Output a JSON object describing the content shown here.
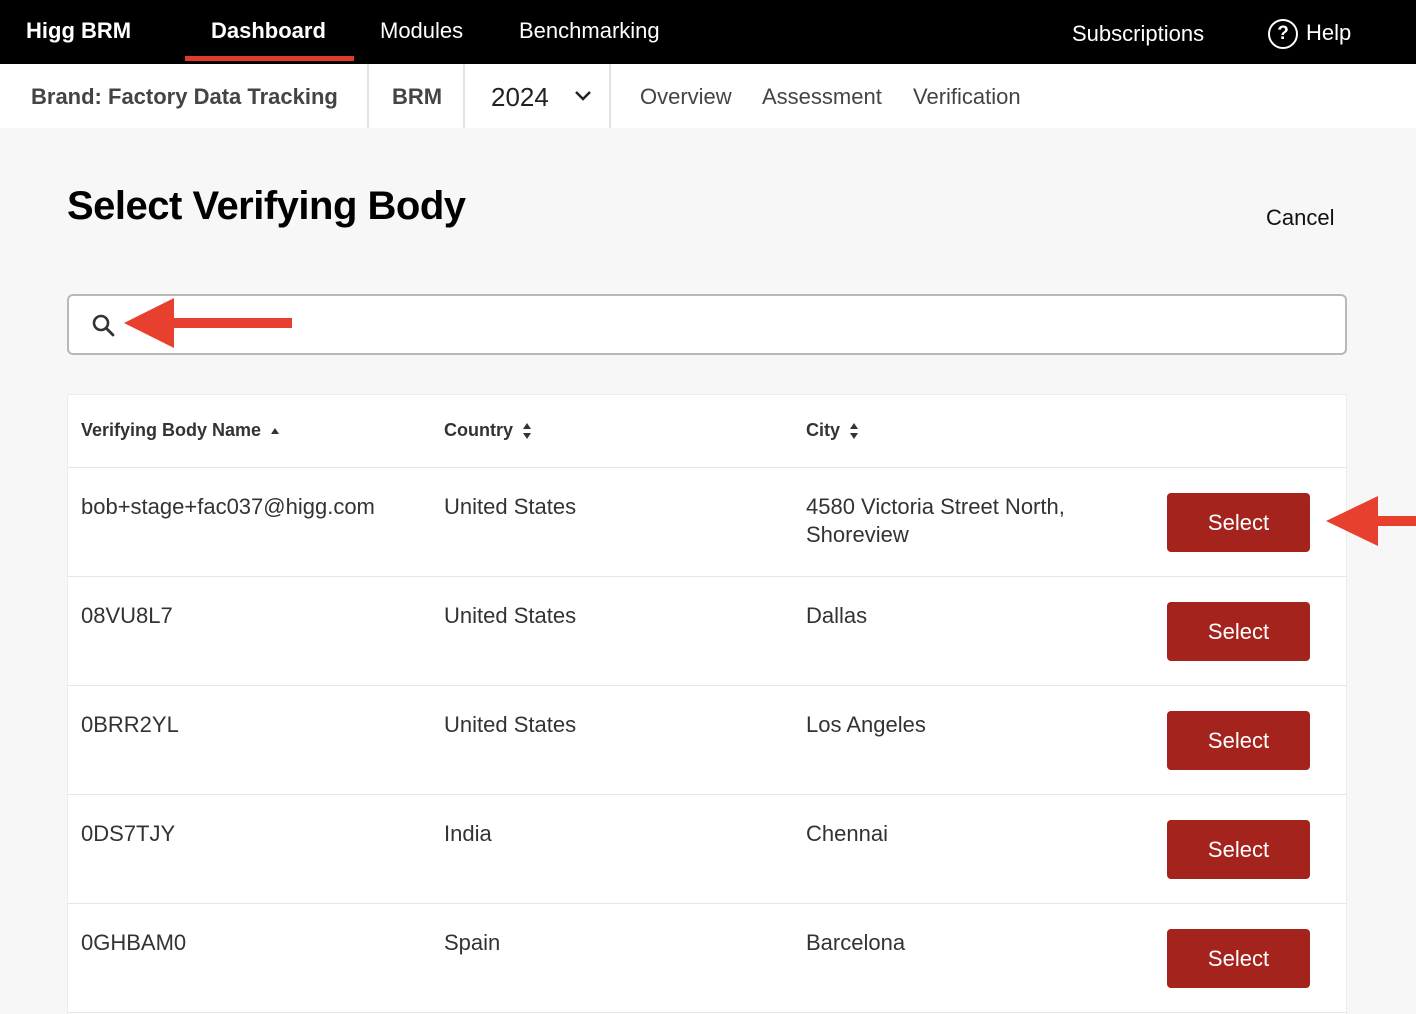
{
  "topnav": {
    "brand": "Higg BRM",
    "items": [
      {
        "label": "Dashboard",
        "active": true
      },
      {
        "label": "Modules"
      },
      {
        "label": "Benchmarking"
      }
    ],
    "subscriptions": "Subscriptions",
    "help": "Help",
    "help_icon_glyph": "?"
  },
  "subnav": {
    "brand_label": "Brand: Factory Data Tracking",
    "module": "BRM",
    "year": "2024",
    "links": [
      "Overview",
      "Assessment",
      "Verification"
    ]
  },
  "page": {
    "title": "Select Verifying Body",
    "cancel": "Cancel"
  },
  "search": {
    "value": "",
    "placeholder": ""
  },
  "table": {
    "columns": [
      {
        "label": "Verifying Body Name",
        "sort": "asc"
      },
      {
        "label": "Country",
        "sort": "none"
      },
      {
        "label": "City",
        "sort": "none"
      }
    ],
    "action_label": "Select",
    "rows": [
      {
        "name": "bob+stage+fac037@higg.com",
        "country": "United States",
        "city": "4580 Victoria Street North, Shoreview"
      },
      {
        "name": "08VU8L7",
        "country": "United States",
        "city": "Dallas"
      },
      {
        "name": "0BRR2YL",
        "country": "United States",
        "city": "Los Angeles"
      },
      {
        "name": "0DS7TJY",
        "country": "India",
        "city": "Chennai"
      },
      {
        "name": "0GHBAM0",
        "country": "Spain",
        "city": "Barcelona"
      }
    ]
  },
  "colors": {
    "accent": "#e03a2f",
    "button": "#a4241d",
    "annotation_arrow": "#e8402f"
  },
  "icons": [
    "search-icon",
    "help-icon",
    "chevron-down-icon",
    "sort-asc-icon",
    "sort-both-icon",
    "arrow-left-icon"
  ]
}
